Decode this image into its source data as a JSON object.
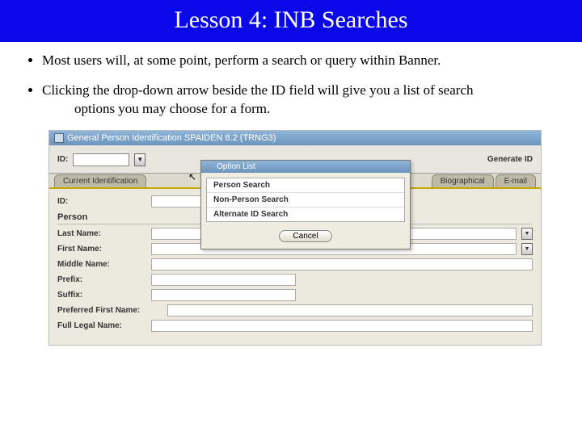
{
  "title": "Lesson 4: INB Searches",
  "bullets": [
    {
      "line1": "Most users will, at some point, perform a search or query within Banner."
    },
    {
      "line1": "Clicking the drop-down arrow beside the ID field will give you a list of search",
      "line2": "options you may choose for a form."
    }
  ],
  "window": {
    "title": "General Person Identification  SPAIDEN  8.2  (TRNG3)",
    "id_label": "ID:",
    "generate": "Generate ID",
    "tabs": {
      "current": "Current Identification",
      "bio": "Biographical",
      "email": "E-mail"
    },
    "section": "Person",
    "fields": {
      "last": "Last Name:",
      "first": "First Name:",
      "middle": "Middle Name:",
      "prefix": "Prefix:",
      "suffix": "Suffix:",
      "pref": "Preferred First Name:",
      "legal": "Full Legal Name:"
    }
  },
  "popup": {
    "title": "Option List",
    "items": [
      "Person Search",
      "Non-Person Search",
      "Alternate ID Search"
    ],
    "cancel": "Cancel"
  }
}
